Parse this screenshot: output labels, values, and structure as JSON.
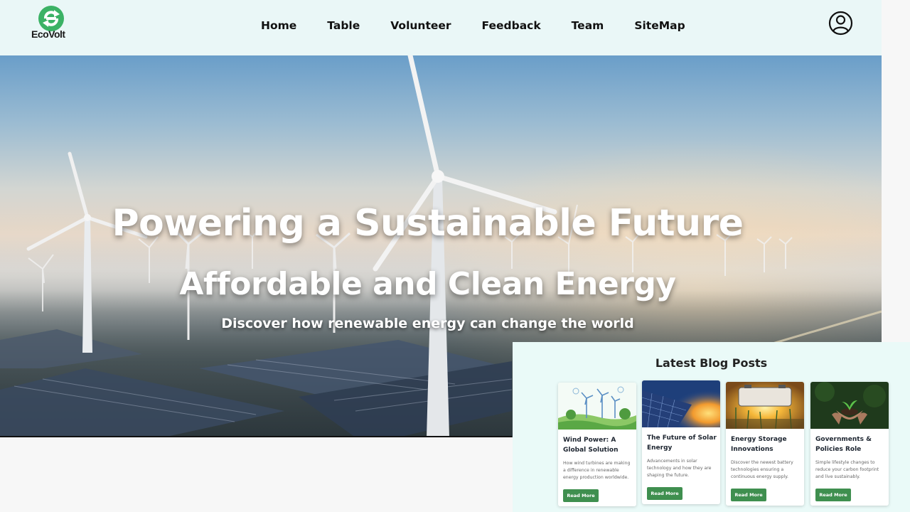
{
  "brand": {
    "name": "EcoVolt"
  },
  "nav": {
    "links": [
      "Home",
      "Table",
      "Volunteer",
      "Feedback",
      "Team",
      "SiteMap"
    ]
  },
  "hero": {
    "title": "Powering a Sustainable Future",
    "subtitle": "Affordable and Clean Energy",
    "tagline": "Discover how renewable energy can change the world"
  },
  "blog": {
    "heading": "Latest Blog Posts",
    "posts": [
      {
        "title": "Wind Power: A Global Solution",
        "description": "How wind turbines are making a difference in renewable energy production worldwide.",
        "button": "Read More"
      },
      {
        "title": "The Future of Solar Energy",
        "description": "Advancements in solar technology and how they are shaping the future.",
        "button": "Read More"
      },
      {
        "title": "Energy Storage Innovations",
        "description": "Discover the newest battery technologies ensuring a continuous energy supply.",
        "button": "Read More"
      },
      {
        "title": "Governments & Policies Role",
        "description": "Simple lifestyle changes to reduce your carbon footprint and live sustainably.",
        "button": "Read More"
      }
    ]
  },
  "colors": {
    "navbar_bg": "#eaf7f7",
    "brand_green": "#3bb265",
    "button_green": "#3f8f4f",
    "blog_bg": "#eafaf8"
  }
}
